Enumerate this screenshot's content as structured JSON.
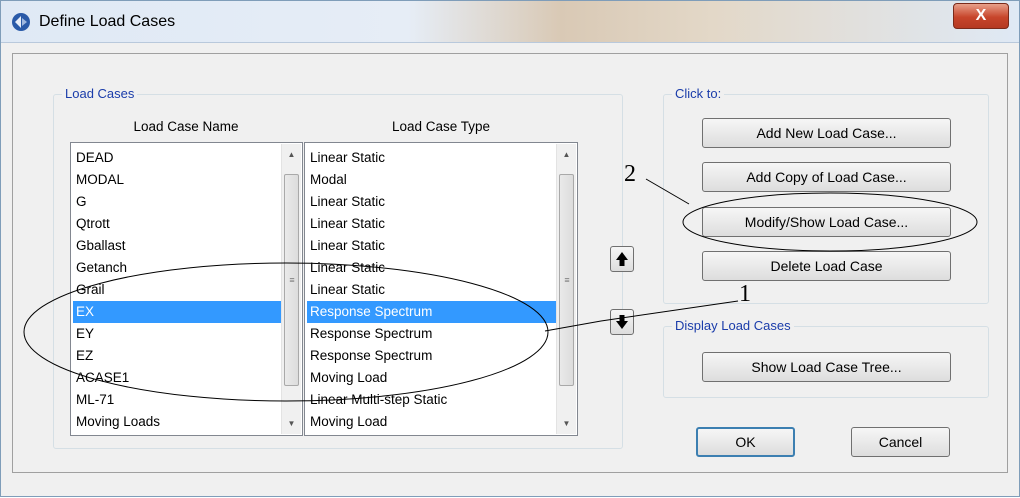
{
  "window": {
    "title": "Define Load Cases",
    "close_glyph": "X",
    "icon": "app-logo-icon"
  },
  "load_cases": {
    "group_label": "Load Cases",
    "name_header": "Load Case Name",
    "type_header": "Load Case Type",
    "names": [
      "DEAD",
      "MODAL",
      "G",
      "Qtrott",
      "Gballast",
      "Getanch",
      "Grail",
      "EX",
      "EY",
      "EZ",
      "ACASE1",
      "ML-71",
      "Moving Loads"
    ],
    "types": [
      "Linear Static",
      "Modal",
      "Linear Static",
      "Linear Static",
      "Linear Static",
      "Linear Static",
      "Linear Static",
      "Response Spectrum",
      "Response Spectrum",
      "Response Spectrum",
      "Moving Load",
      "Linear Multi-step Static",
      "Moving Load"
    ],
    "selected_index": 7,
    "move_up_icon": "arrow-up-icon",
    "move_down_icon": "arrow-down-icon"
  },
  "click_to": {
    "group_label": "Click to:",
    "add_new": "Add New Load Case...",
    "add_copy": "Add Copy of Load Case...",
    "modify_show": "Modify/Show Load Case...",
    "delete": "Delete Load Case"
  },
  "display": {
    "group_label": "Display Load Cases",
    "show_tree": "Show Load Case Tree..."
  },
  "footer": {
    "ok": "OK",
    "cancel": "Cancel"
  },
  "annotations": {
    "label_1": "1",
    "label_2": "2"
  }
}
